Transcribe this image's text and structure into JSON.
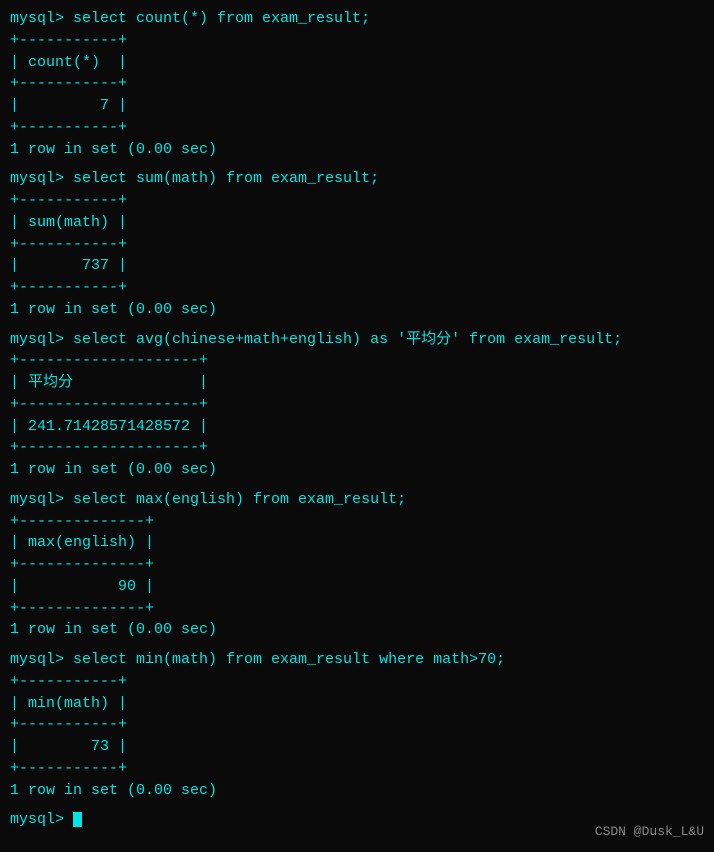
{
  "terminal": {
    "watermark": "CSDN @Dusk_L&U",
    "blocks": [
      {
        "id": "block1",
        "prompt": "mysql> ",
        "command": "select count(*) from exam_result;",
        "table": {
          "border_top": "+-----------+",
          "header": "| count(*)  |",
          "border_mid": "+-----------+",
          "row": "|         7 |",
          "border_bot": "+-----------+"
        },
        "result_info": "1 row in set (0.00 sec)"
      },
      {
        "id": "block2",
        "prompt": "mysql> ",
        "command": "select sum(math) from exam_result;",
        "table": {
          "border_top": "+-----------+",
          "header": "| sum(math) |",
          "border_mid": "+-----------+",
          "row": "|       737 |",
          "border_bot": "+-----------+"
        },
        "result_info": "1 row in set (0.00 sec)"
      },
      {
        "id": "block3",
        "prompt": "mysql> ",
        "command": "select avg(chinese+math+english) as '平均分' from exam_result;",
        "table": {
          "border_top": "+--------------------+",
          "header": "| 平均分              |",
          "border_mid": "+--------------------+",
          "row": "| 241.71428571428572 |",
          "border_bot": "+--------------------+"
        },
        "result_info": "1 row in set (0.00 sec)"
      },
      {
        "id": "block4",
        "prompt": "mysql> ",
        "command": "select max(english) from exam_result;",
        "table": {
          "border_top": "+--------------+",
          "header": "| max(english) |",
          "border_mid": "+--------------+",
          "row": "|           90 |",
          "border_bot": "+--------------+"
        },
        "result_info": "1 row in set (0.00 sec)"
      },
      {
        "id": "block5",
        "prompt": "mysql> ",
        "command": "select min(math) from exam_result where math>70;",
        "table": {
          "border_top": "+-----------+",
          "header": "| min(math) |",
          "border_mid": "+-----------+",
          "row": "|        73 |",
          "border_bot": "+-----------+"
        },
        "result_info": "1 row in set (0.00 sec)"
      },
      {
        "id": "block6",
        "prompt": "mysql> ",
        "command": "_",
        "table": null,
        "result_info": null
      }
    ]
  }
}
